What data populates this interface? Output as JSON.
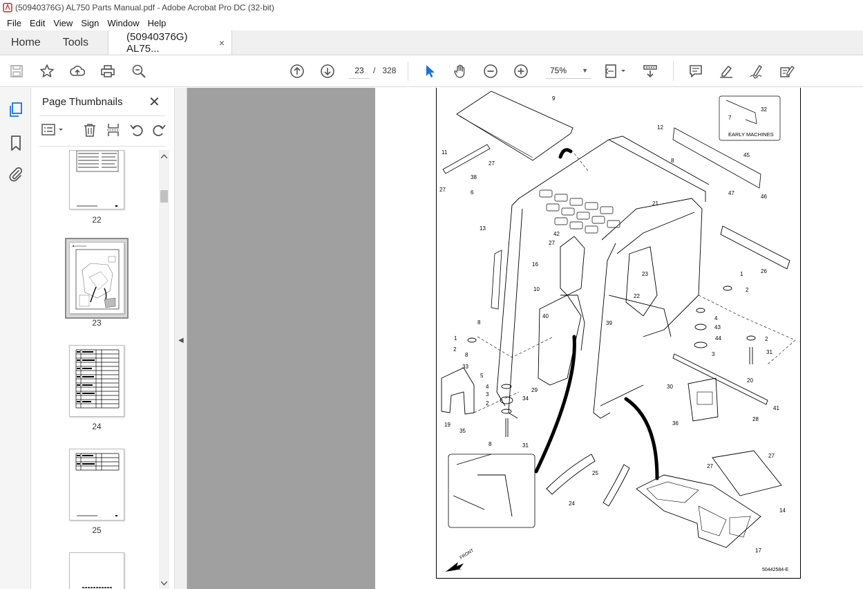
{
  "window": {
    "title": "(50940376G) AL750 Parts Manual.pdf - Adobe Acrobat Pro DC (32-bit)"
  },
  "menu": [
    "File",
    "Edit",
    "View",
    "Sign",
    "Window",
    "Help"
  ],
  "tabs": {
    "home": "Home",
    "tools": "Tools",
    "document": "(50940376G) AL75...",
    "close": "×"
  },
  "toolbar": {
    "current_page": "23",
    "page_sep": "/",
    "total_pages": "328",
    "zoom": "75%"
  },
  "panel": {
    "title": "Page Thumbnails",
    "close": "✕",
    "thumbnails": [
      {
        "label": "22"
      },
      {
        "label": "23",
        "selected": true
      },
      {
        "label": "24"
      },
      {
        "label": "25"
      }
    ]
  },
  "diagram": {
    "inset_label": "EARLY MACHINES",
    "drawing_number": "50442584-E",
    "front_label": "FRONT",
    "callouts": [
      "9",
      "32",
      "7",
      "12",
      "11",
      "27",
      "38",
      "27",
      "6",
      "8",
      "45",
      "47",
      "46",
      "13",
      "42",
      "27",
      "21",
      "16",
      "10",
      "40",
      "39",
      "26",
      "1",
      "2",
      "23",
      "22",
      "8",
      "1",
      "2",
      "8",
      "33",
      "5",
      "4",
      "3",
      "2",
      "34",
      "29",
      "4",
      "43",
      "44",
      "3",
      "2",
      "31",
      "20",
      "30",
      "41",
      "36",
      "28",
      "19",
      "35",
      "31",
      "8",
      "27",
      "27",
      "25",
      "24",
      "14",
      "17"
    ]
  },
  "colors": {
    "viewer_bg": "#a0a0a0",
    "accent_blue": "#1473e6",
    "pdf_red": "#d4261c"
  }
}
